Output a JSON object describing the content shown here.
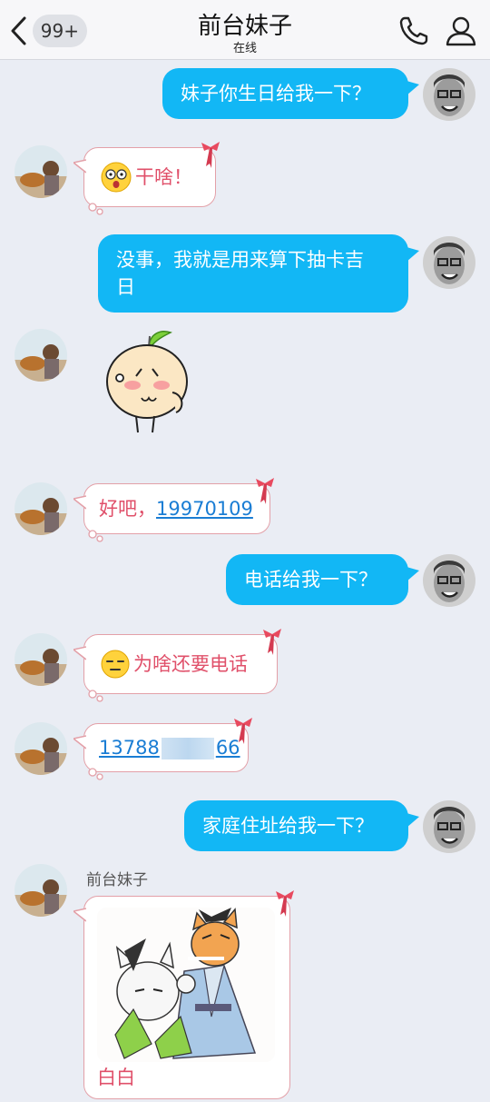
{
  "header": {
    "unread_badge": "99+",
    "title": "前台妹子",
    "status": "在线"
  },
  "messages": [
    {
      "from": "me",
      "text": "妹子你生日给我一下？"
    },
    {
      "from": "her",
      "text": "干啥！",
      "emoji": "shocked-face-icon"
    },
    {
      "from": "me",
      "text_line1": "没事，我就是用来算下抽卡吉",
      "text_line2": "日"
    },
    {
      "from": "her",
      "sticker": "shy-orange-sticker"
    },
    {
      "from": "her",
      "prefix": "好吧，",
      "link": "19970109"
    },
    {
      "from": "me",
      "text": "电话给我一下？"
    },
    {
      "from": "her",
      "text": "为啥还要电话",
      "emoji": "smug-face-icon"
    },
    {
      "from": "her",
      "link_start": "13788",
      "link_end": "66"
    },
    {
      "from": "me",
      "text": "家庭住址给我一下？"
    },
    {
      "from": "her",
      "sender_name": "前台妹子",
      "image": "cartoon-cats-image",
      "caption": "白白"
    }
  ],
  "colors": {
    "my_bubble": "#12b7f5",
    "her_text": "#e0506a",
    "her_border": "#e3a0a8",
    "link": "#1a7dd4",
    "background": "#eaedf4"
  }
}
